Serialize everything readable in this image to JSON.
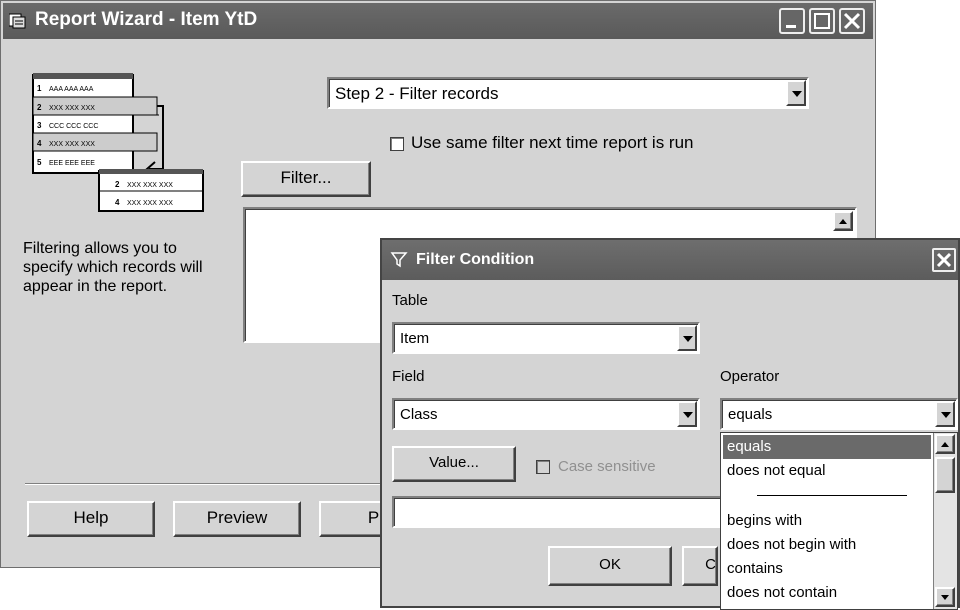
{
  "window": {
    "title": "Report Wizard - Item YtD"
  },
  "wizard": {
    "step_select": "Step 2 - Filter records",
    "same_filter_label": "Use same filter next time report is run",
    "filter_button": "Filter...",
    "description": "Filtering allows you to specify which records will appear in the report.",
    "illustration": {
      "rows": [
        {
          "num": "1",
          "text": "AAA AAA AAA"
        },
        {
          "num": "2",
          "text": "XXX XXX XXX"
        },
        {
          "num": "3",
          "text": "CCC CCC CCC"
        },
        {
          "num": "4",
          "text": "XXX XXX XXX"
        },
        {
          "num": "5",
          "text": "EEE EEE EEE"
        }
      ],
      "result_rows": [
        {
          "num": "2",
          "text": "XXX XXX XXX"
        },
        {
          "num": "4",
          "text": "XXX XXX XXX"
        }
      ]
    }
  },
  "footer": {
    "help": "Help",
    "preview": "Preview",
    "print_partial": "Prin"
  },
  "dialog": {
    "title": "Filter Condition",
    "table_label": "Table",
    "table_value": "Item",
    "field_label": "Field",
    "field_value": "Class",
    "operator_label": "Operator",
    "operator_value": "equals",
    "value_button": "Value...",
    "case_sensitive": "Case sensitive",
    "ok": "OK",
    "cancel_partial": "C",
    "operator_options": [
      "equals",
      "does not equal",
      "begins with",
      "does not begin with",
      "contains",
      "does not contain"
    ]
  }
}
